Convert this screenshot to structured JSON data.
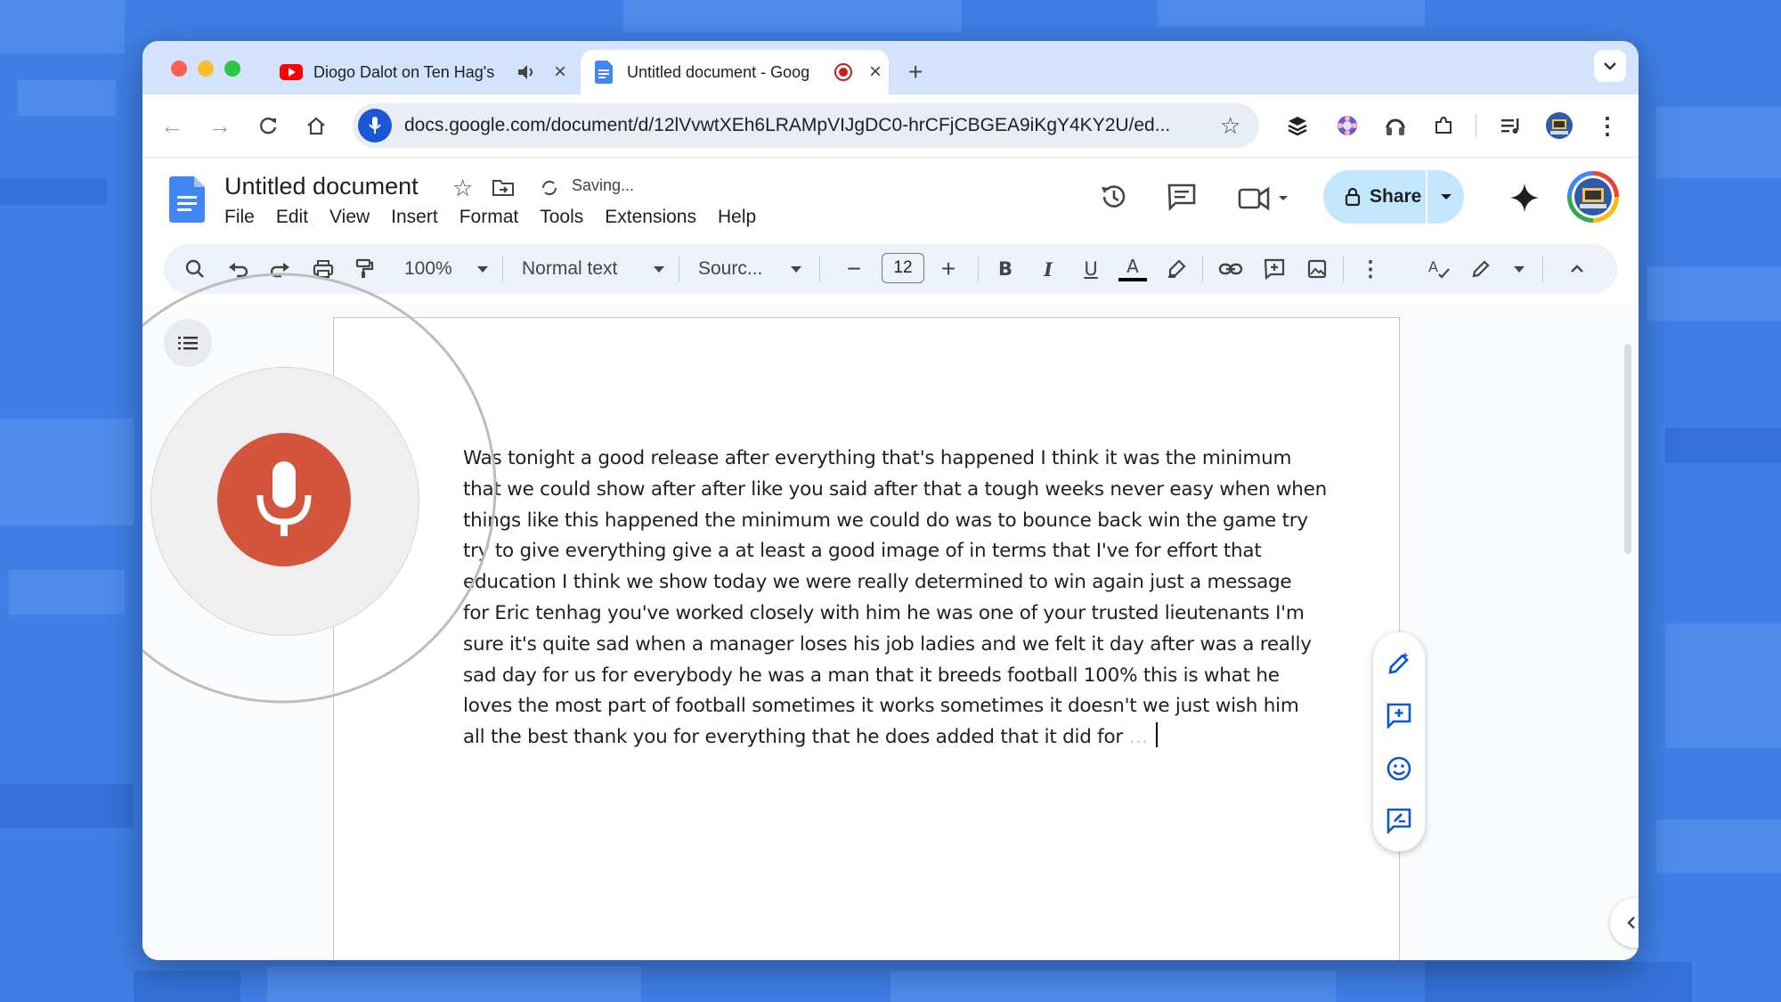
{
  "browser": {
    "tabs": [
      {
        "title": "Diogo Dalot on Ten Hag's",
        "active": false
      },
      {
        "title": "Untitled document - Goog",
        "active": true
      }
    ],
    "url": "docs.google.com/document/d/12lVvwtXEh6LRAMpVIJgDC0-hrCFjCBGEA9iKgY4KY2U/ed..."
  },
  "docs": {
    "title": "Untitled document",
    "status": "Saving...",
    "menu": [
      "File",
      "Edit",
      "View",
      "Insert",
      "Format",
      "Tools",
      "Extensions",
      "Help"
    ],
    "share_label": "Share",
    "toolbar": {
      "zoom": "100%",
      "style": "Normal text",
      "font": "Sourc...",
      "font_size": "12"
    },
    "body_lines": [
      "Was tonight a good release after everything that's happened I think it was the minimum",
      "that we could show after after like you said after that a tough weeks never easy when when",
      "things like this happened the minimum we could do was to bounce back win the game try",
      "try to give everything give a at least a good image of in terms that I've for effort that",
      "education I think we show today we were really determined to win again just a message",
      "for Eric tenhag you've worked closely with him he was one of your trusted lieutenants I'm",
      "sure it's quite sad when a manager loses his job ladies and we felt it day after was a really",
      "sad day for us for everybody he was a man that it breeds football 100% this is what he",
      "loves the most part of football sometimes it works sometimes it doesn't we just wish him",
      "all the best thank you for everything that he does added that it did for"
    ],
    "pending_text": "…",
    "voice_typing": {
      "listening": true
    }
  },
  "colors": {
    "mic_red": "#d4553e",
    "share_bg": "#c2e7ff",
    "tabstrip": "#d3e3fd",
    "desktop_blue": "#3f7fe6"
  }
}
